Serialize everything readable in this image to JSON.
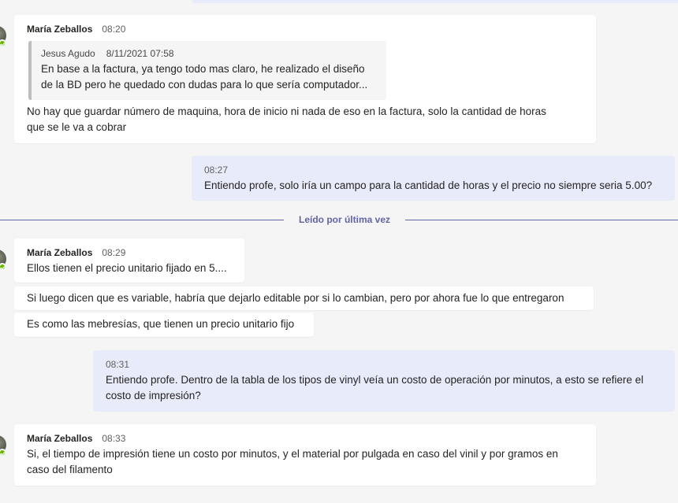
{
  "thread": {
    "msg1": {
      "author": "María Zeballos",
      "time": "08:20",
      "quote": {
        "author": "Jesus Agudo",
        "time": "8/11/2021 07:58",
        "line1": "En base a la factura, ya tengo todo mas claro, he realizado el diseño",
        "line2": "de la BD pero he quedado con dudas para lo que sería computador..."
      },
      "line1": "No hay que guardar número de maquina, hora de inicio ni nada de eso en la factura, solo la cantidad de horas",
      "line2": "que se le va a cobrar"
    },
    "msg2": {
      "time": "08:27",
      "text": "Entiendo profe, solo iría un campo para la cantidad de horas y el precio no siempre seria 5.00?"
    },
    "divider": "Leído por última vez",
    "msg3": {
      "author": "María Zeballos",
      "time": "08:29",
      "text": "Ellos tienen el precio unitario fijado en 5...."
    },
    "msg4": {
      "text": "Si luego dicen que es variable, habría que dejarlo editable por si lo cambian, pero por ahora fue lo que entregaron"
    },
    "msg5": {
      "text": "Es como las mebresías, que tienen un precio unitario fijo"
    },
    "msg6": {
      "time": "08:31",
      "line1": "Entiendo profe. Dentro de la tabla de los tipos de vinyl veía un costo de operación por minutos, a esto se refiere el",
      "line2": "costo de impresión?"
    },
    "msg7": {
      "author": "María Zeballos",
      "time": "08:33",
      "line1": "Si, el tiempo de impresión tiene un costo por minutos, y el material por pulgada en caso del vinil y por gramos en",
      "line2": "caso del filamento"
    }
  },
  "colors": {
    "accent": "#6264a7",
    "presence": "#6bb700",
    "own_bubble": "#e8ebfa"
  }
}
